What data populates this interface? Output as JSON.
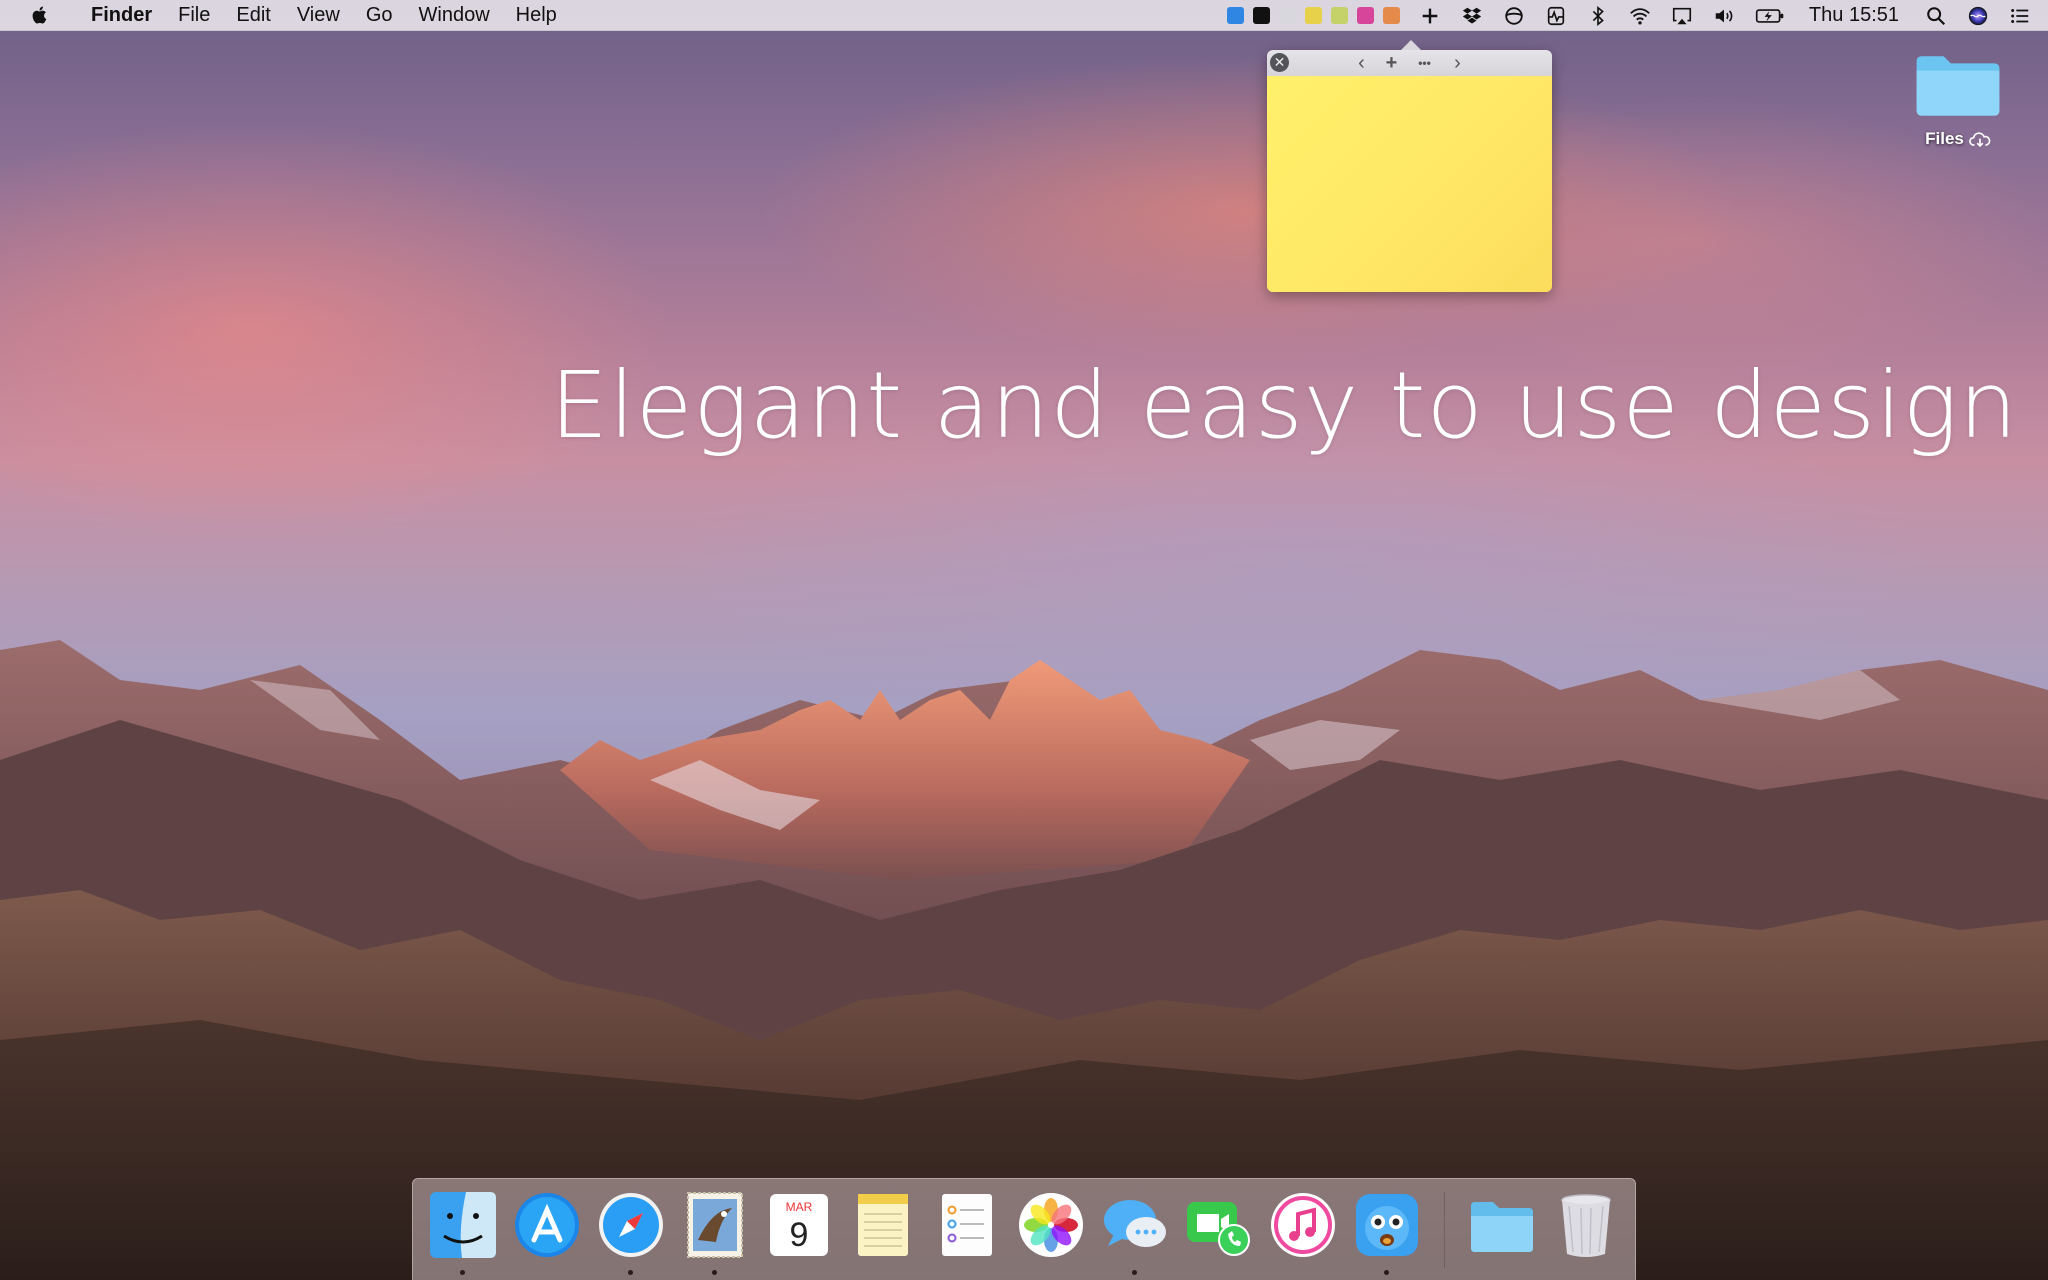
{
  "menubar": {
    "app_name": "Finder",
    "menus": [
      "File",
      "Edit",
      "View",
      "Go",
      "Window",
      "Help"
    ],
    "clock": "Thu 15:51",
    "note_swatches": [
      "#2f87e3",
      "#111111",
      "#d9d7de",
      "#e8d14a",
      "#c5d26a",
      "#d6459a",
      "#e48a4a"
    ],
    "status_icons": [
      "plus-icon",
      "dropbox-icon",
      "circle-icon",
      "activity-icon",
      "bluetooth-icon",
      "wifi-icon",
      "airplay-icon",
      "volume-icon",
      "battery-icon"
    ]
  },
  "note": {
    "close_glyph": "✕",
    "prev_glyph": "‹",
    "add_glyph": "+",
    "more_glyph": "•••",
    "next_glyph": "›",
    "color": "#ffe866"
  },
  "desktop": {
    "folder_label": "Files",
    "headline": "Elegant and easy to use design"
  },
  "dock": {
    "calendar_month": "MAR",
    "calendar_day": "9",
    "items": [
      "finder",
      "app-store",
      "safari",
      "mail",
      "calendar",
      "notes",
      "reminders",
      "photos",
      "messages",
      "facetime",
      "itunes",
      "tweetbot",
      "downloads-folder",
      "trash"
    ]
  }
}
